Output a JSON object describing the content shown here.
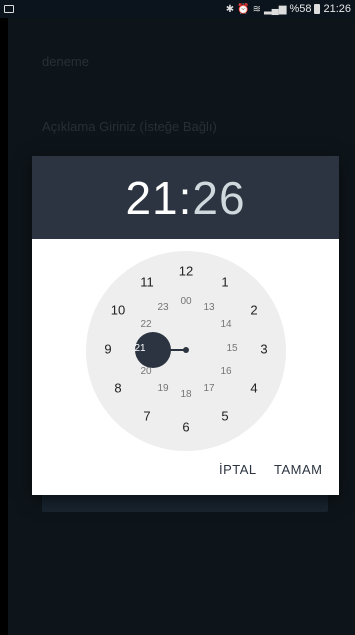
{
  "status_bar": {
    "battery": "%58",
    "time": "21:26"
  },
  "background": {
    "title_value": "deneme",
    "description_placeholder": "Açıklama Giriniz (İsteğe Bağlı)"
  },
  "time_picker": {
    "hour": "21",
    "separator": ":",
    "minute": "26",
    "selected_hour": "21",
    "outer_numbers": [
      "12",
      "1",
      "2",
      "3",
      "4",
      "5",
      "6",
      "7",
      "8",
      "9",
      "10",
      "11"
    ],
    "inner_numbers": [
      "00",
      "13",
      "14",
      "15",
      "16",
      "17",
      "18",
      "19",
      "20",
      "21",
      "22",
      "23"
    ],
    "cancel_label": "İPTAL",
    "ok_label": "TAMAM"
  },
  "colors": {
    "header_bg": "#2b3440",
    "app_bg": "#1a2731",
    "clock_face": "#eeeeee"
  }
}
